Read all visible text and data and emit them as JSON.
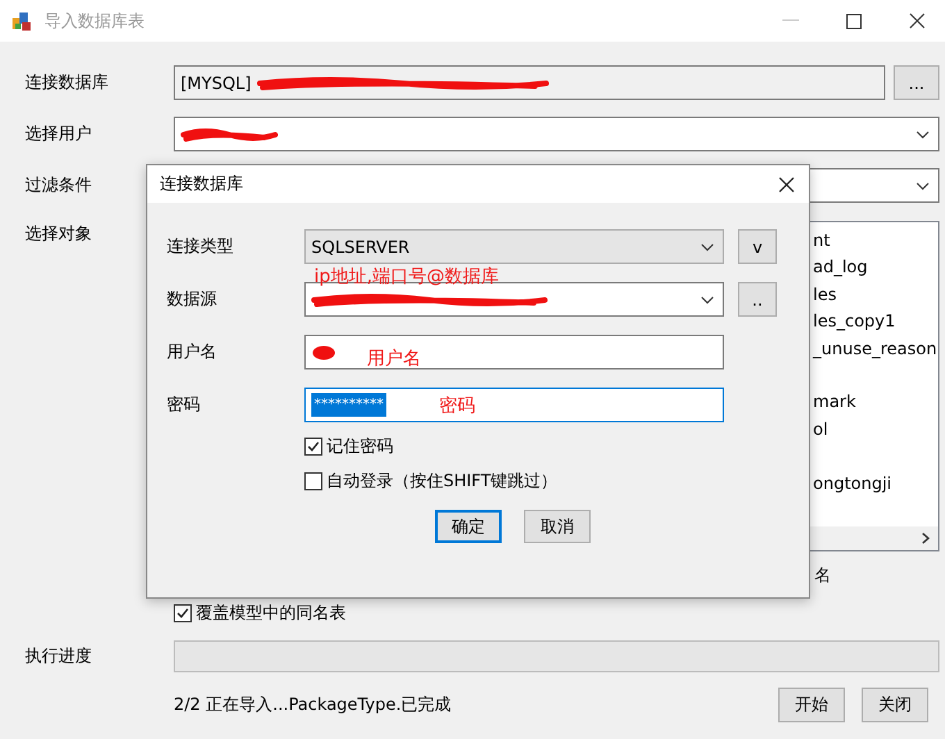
{
  "window": {
    "title": "导入数据库表"
  },
  "form": {
    "connection": {
      "label": "连接数据库",
      "value": "[MYSQL]",
      "redacted": true,
      "button": "..."
    },
    "user": {
      "label": "选择用户",
      "redacted": true
    },
    "filter": {
      "label": "过滤条件"
    },
    "objects": {
      "label": "选择对象",
      "items": [
        "nt",
        "ad_log",
        "les",
        "les_copy1",
        "_unuse_reason",
        "mark",
        "ol",
        "ongtongji"
      ]
    },
    "partial_option": {
      "label": "名"
    },
    "overwrite": {
      "label": "覆盖模型中的同名表",
      "checked": true
    },
    "progress": {
      "label": "执行进度",
      "level": 0
    },
    "status": "2/2 正在导入...PackageType.已完成",
    "buttons": [
      "开始",
      "关闭"
    ]
  },
  "dialog": {
    "title": "连接数据库",
    "type": {
      "label": "连接类型",
      "value": "SQLSERVER",
      "button": "v"
    },
    "source": {
      "label": "数据源",
      "redacted": true,
      "button": "..",
      "note": "ip地址,端口号@数据库"
    },
    "username": {
      "label": "用户名",
      "redacted": true,
      "note": "用户名"
    },
    "password": {
      "label": "密码",
      "value": "**********",
      "note": "密码"
    },
    "remember": {
      "label": "记住密码",
      "checked": true
    },
    "autologin": {
      "label": "自动登录（按住SHIFT键跳过）",
      "checked": false
    },
    "buttons": [
      "确定",
      "取消"
    ]
  }
}
